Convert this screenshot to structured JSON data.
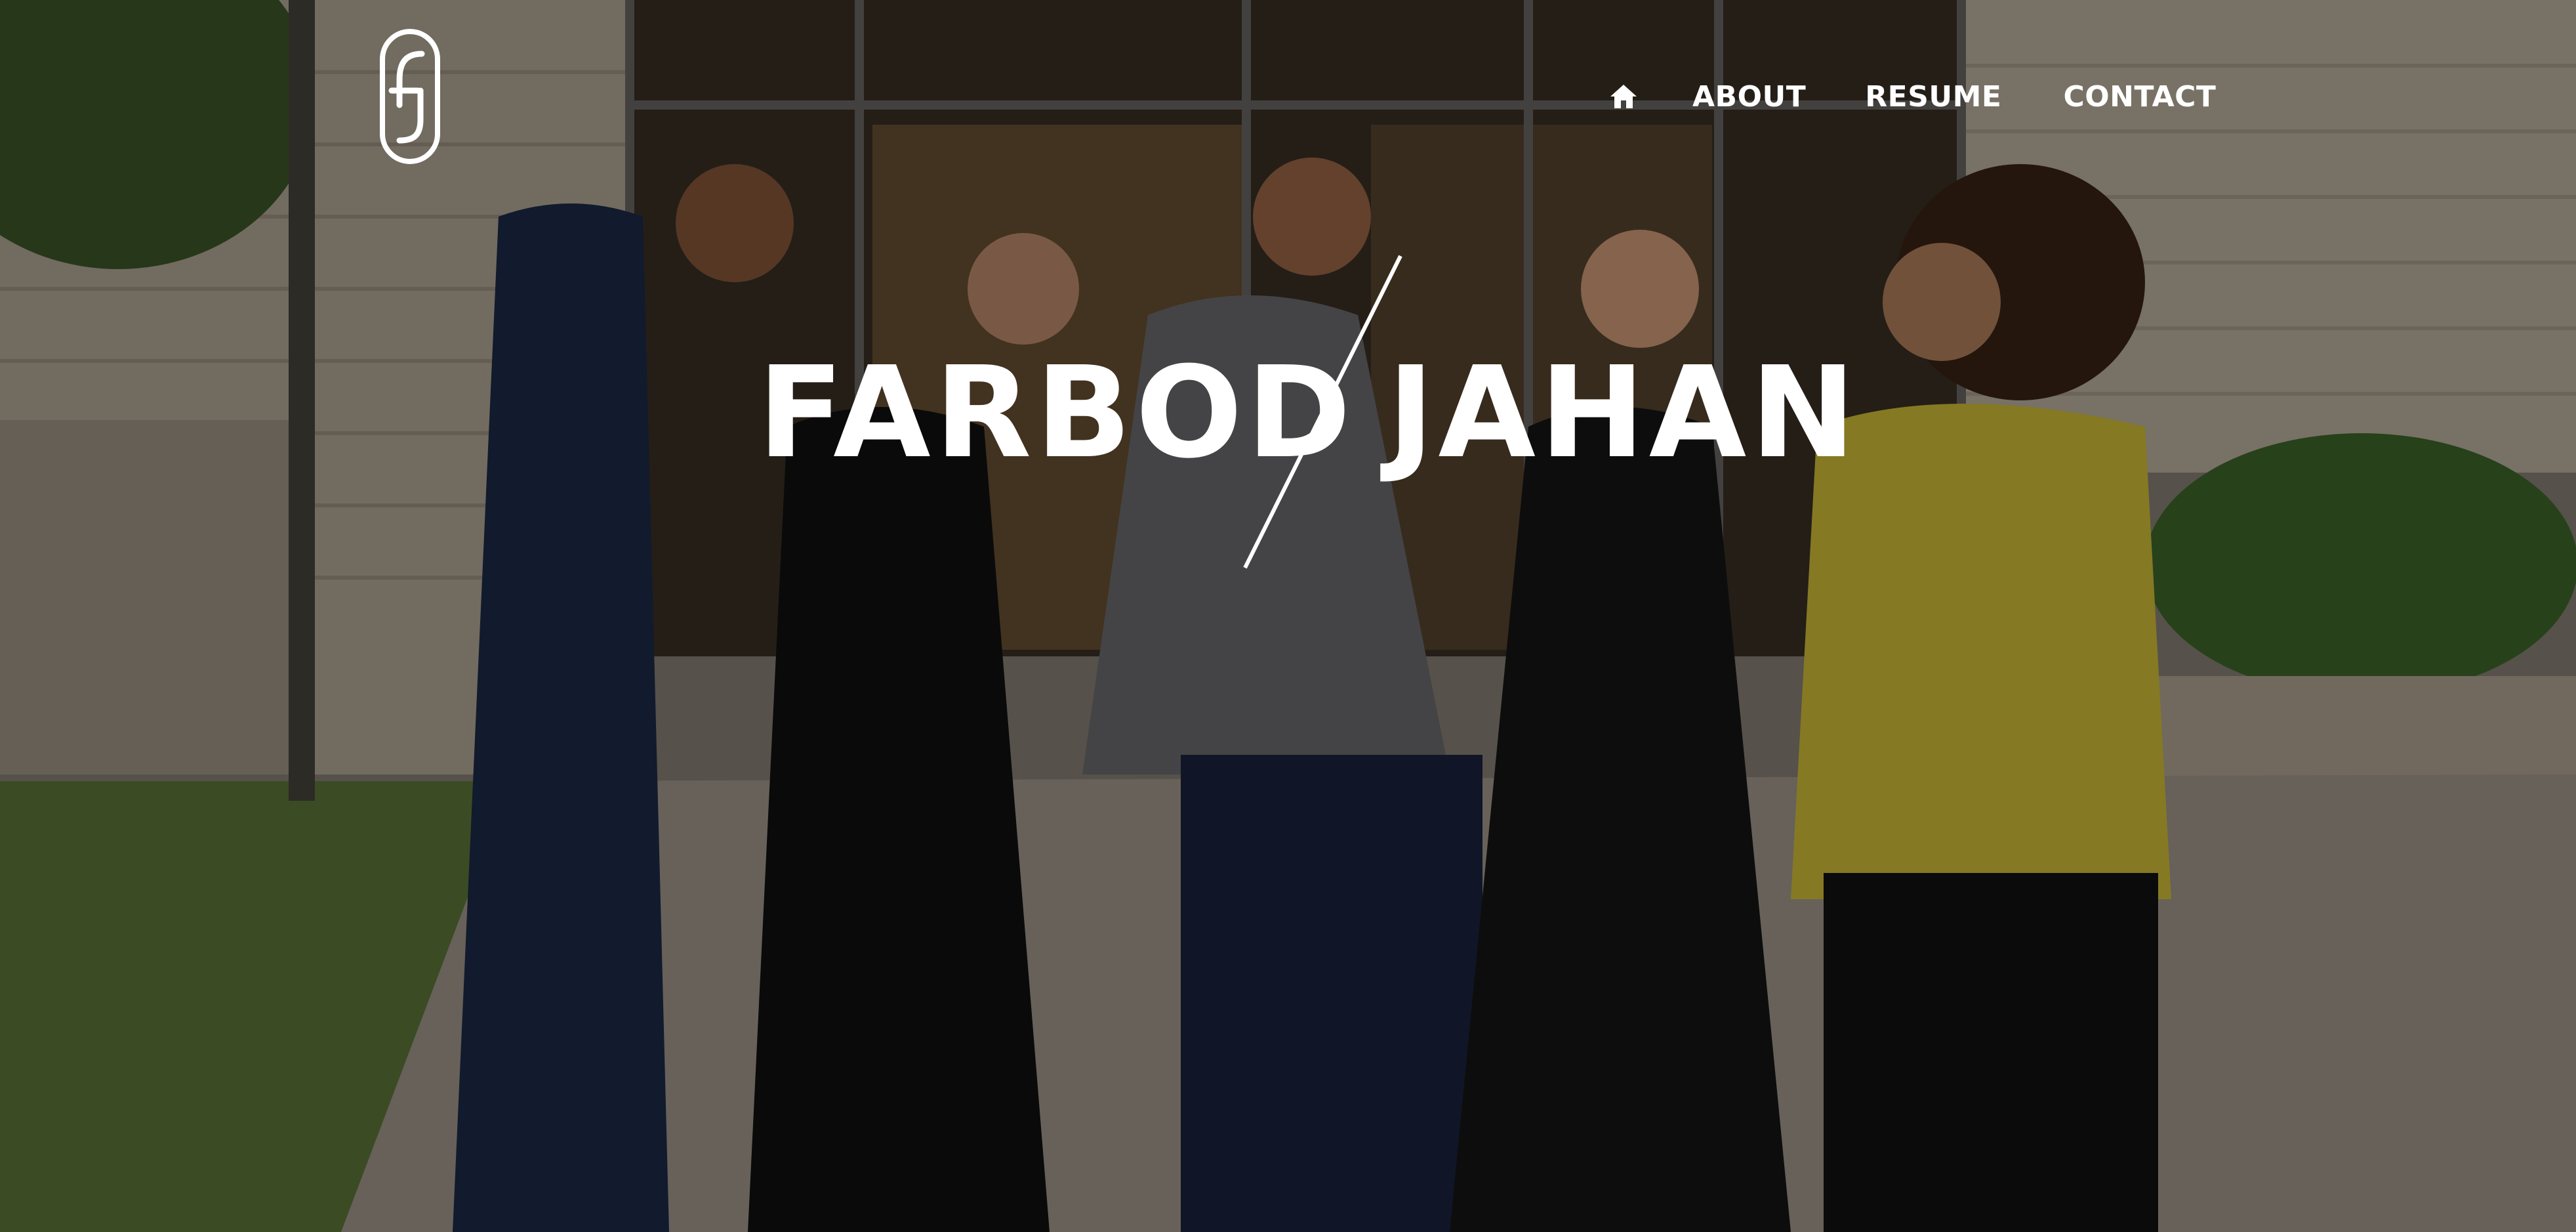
{
  "brand": {
    "logo_icon": "fj-monogram-icon",
    "wordmark_first": "FARBOD",
    "wordmark_last": "JAHAN"
  },
  "nav": {
    "home_icon": "home-icon",
    "items": [
      {
        "label": "ABOUT"
      },
      {
        "label": "RESUME"
      },
      {
        "label": "CONTACT"
      }
    ]
  },
  "hero": {
    "photo": "team-group-photo"
  },
  "colors": {
    "text": "#ffffff",
    "overlay": "rgba(0,0,0,0.38)"
  }
}
